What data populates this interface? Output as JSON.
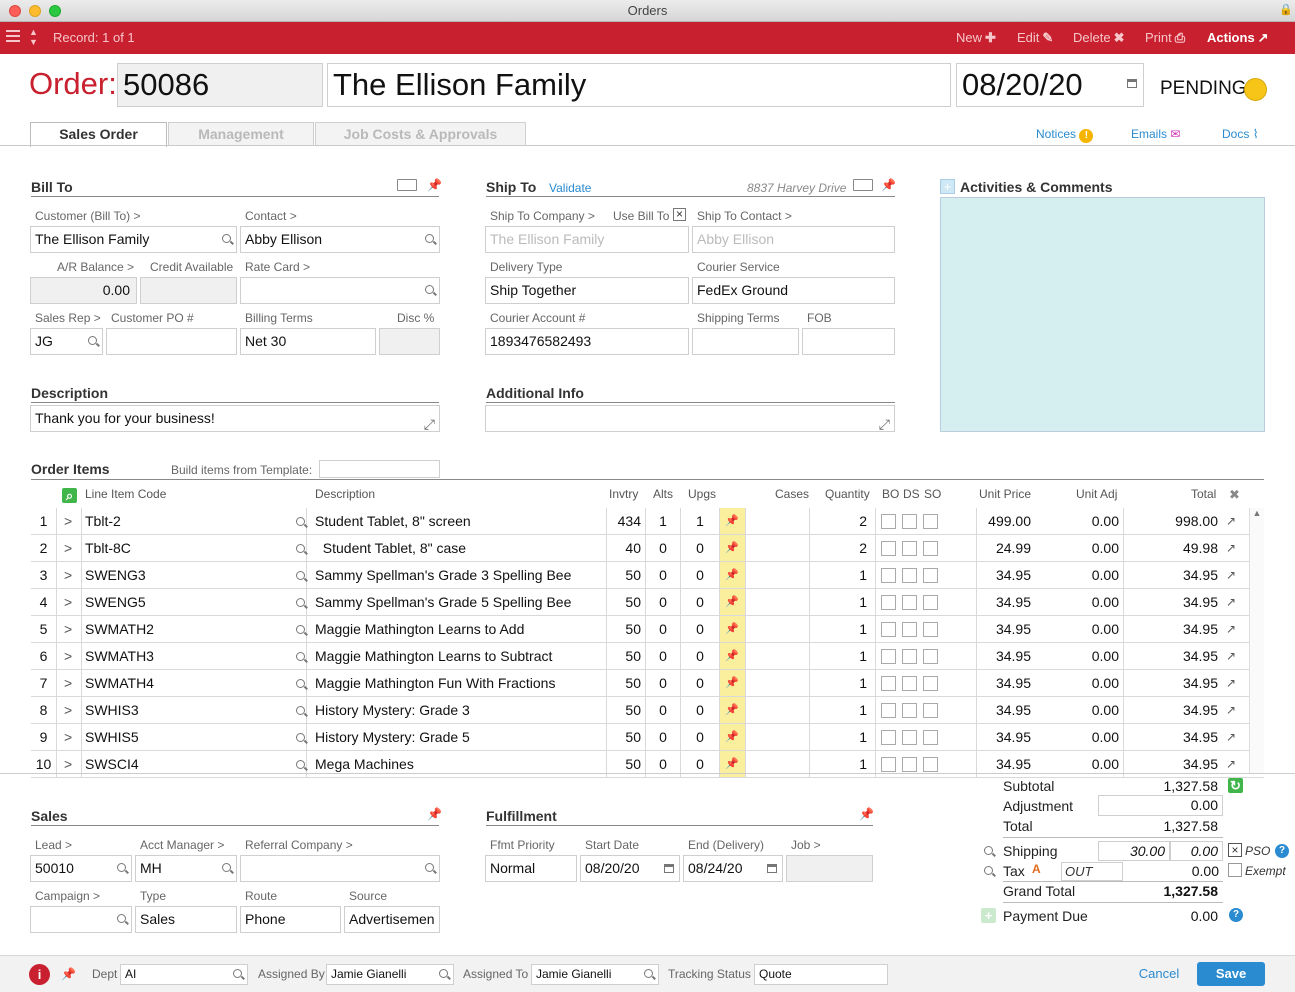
{
  "window": {
    "title": "Orders"
  },
  "toolbar": {
    "record": "Record: 1 of 1",
    "new": "New",
    "edit": "Edit",
    "delete": "Delete",
    "print": "Print",
    "actions": "Actions"
  },
  "header": {
    "order_label": "Order:",
    "order_number": "50086",
    "customer_name": "The Ellison Family",
    "date": "08/20/20",
    "status": "PENDING"
  },
  "tabs": [
    {
      "label": "Sales Order"
    },
    {
      "label": "Management"
    },
    {
      "label": "Job Costs & Approvals"
    }
  ],
  "toplinks": {
    "notices": "Notices",
    "emails": "Emails",
    "docs": "Docs"
  },
  "bill_to": {
    "title": "Bill To",
    "customer_label": "Customer (Bill To) >",
    "customer": "The Ellison Family",
    "contact_label": "Contact >",
    "contact": "Abby Ellison",
    "ar_label": "A/R Balance >",
    "ar": "0.00",
    "credit_label": "Credit Available",
    "credit": "",
    "ratecard_label": "Rate Card >",
    "ratecard": "",
    "salesrep_label": "Sales Rep >",
    "salesrep": "JG",
    "custpo_label": "Customer PO #",
    "custpo": "",
    "terms_label": "Billing Terms",
    "terms": "Net 30",
    "disc_label": "Disc %",
    "disc": ""
  },
  "ship_to": {
    "title": "Ship To",
    "validate": "Validate",
    "address_hint": "8837 Harvey Drive",
    "company_label": "Ship To Company >",
    "company": "The Ellison Family",
    "use_bill_label": "Use Bill To",
    "use_bill_mark": "×",
    "contact_label": "Ship To Contact >",
    "contact": "Abby Ellison",
    "delivery_label": "Delivery Type",
    "delivery": "Ship Together",
    "courier_label": "Courier Service",
    "courier": "FedEx Ground",
    "account_label": "Courier Account #",
    "account": "1893476582493",
    "shipterms_label": "Shipping Terms",
    "shipterms": "",
    "fob_label": "FOB",
    "fob": ""
  },
  "activities": {
    "title": "Activities & Comments"
  },
  "description": {
    "title": "Description",
    "value": "Thank you for your business!"
  },
  "additional": {
    "title": "Additional Info",
    "value": ""
  },
  "order_items": {
    "title": "Order Items",
    "template_label": "Build items from Template:",
    "columns": {
      "code": "Line Item Code",
      "desc": "Description",
      "invtry": "Invtry",
      "alts": "Alts",
      "upgs": "Upgs",
      "cases": "Cases",
      "qty": "Quantity",
      "bo": "BO",
      "ds": "DS",
      "so": "SO",
      "unit": "Unit Price",
      "adj": "Unit Adj",
      "total": "Total"
    },
    "rows": [
      {
        "n": "1",
        "code": "Tblt-2",
        "desc": "Student Tablet, 8\" screen",
        "inv": "434",
        "alts": "1",
        "upgs": "1",
        "qty": "2",
        "price": "499.00",
        "adj": "0.00",
        "total": "998.00"
      },
      {
        "n": "2",
        "code": "Tblt-8C",
        "desc": "  Student Tablet, 8\" case",
        "inv": "40",
        "alts": "0",
        "upgs": "0",
        "qty": "2",
        "price": "24.99",
        "adj": "0.00",
        "total": "49.98"
      },
      {
        "n": "3",
        "code": "SWENG3",
        "desc": "Sammy Spellman's Grade 3 Spelling Bee",
        "inv": "50",
        "alts": "0",
        "upgs": "0",
        "qty": "1",
        "price": "34.95",
        "adj": "0.00",
        "total": "34.95"
      },
      {
        "n": "4",
        "code": "SWENG5",
        "desc": "Sammy Spellman's Grade 5 Spelling Bee",
        "inv": "50",
        "alts": "0",
        "upgs": "0",
        "qty": "1",
        "price": "34.95",
        "adj": "0.00",
        "total": "34.95"
      },
      {
        "n": "5",
        "code": "SWMATH2",
        "desc": "Maggie Mathington Learns to Add",
        "inv": "50",
        "alts": "0",
        "upgs": "0",
        "qty": "1",
        "price": "34.95",
        "adj": "0.00",
        "total": "34.95"
      },
      {
        "n": "6",
        "code": "SWMATH3",
        "desc": "Maggie Mathington Learns to Subtract",
        "inv": "50",
        "alts": "0",
        "upgs": "0",
        "qty": "1",
        "price": "34.95",
        "adj": "0.00",
        "total": "34.95"
      },
      {
        "n": "7",
        "code": "SWMATH4",
        "desc": "Maggie Mathington Fun With Fractions",
        "inv": "50",
        "alts": "0",
        "upgs": "0",
        "qty": "1",
        "price": "34.95",
        "adj": "0.00",
        "total": "34.95"
      },
      {
        "n": "8",
        "code": "SWHIS3",
        "desc": "History Mystery: Grade 3",
        "inv": "50",
        "alts": "0",
        "upgs": "0",
        "qty": "1",
        "price": "34.95",
        "adj": "0.00",
        "total": "34.95"
      },
      {
        "n": "9",
        "code": "SWHIS5",
        "desc": "History Mystery: Grade 5",
        "inv": "50",
        "alts": "0",
        "upgs": "0",
        "qty": "1",
        "price": "34.95",
        "adj": "0.00",
        "total": "34.95"
      },
      {
        "n": "10",
        "code": "SWSCI4",
        "desc": "Mega Machines",
        "inv": "50",
        "alts": "0",
        "upgs": "0",
        "qty": "1",
        "price": "34.95",
        "adj": "0.00",
        "total": "34.95"
      }
    ]
  },
  "sales": {
    "title": "Sales",
    "lead_label": "Lead >",
    "lead": "50010",
    "acct_label": "Acct Manager >",
    "acct": "MH",
    "ref_label": "Referral Company >",
    "ref": "",
    "campaign_label": "Campaign >",
    "campaign": "",
    "type_label": "Type",
    "type": "Sales",
    "route_label": "Route",
    "route": "Phone",
    "source_label": "Source",
    "source": "Advertisemen"
  },
  "fulfillment": {
    "title": "Fulfillment",
    "priority_label": "Ffmt Priority",
    "priority": "Normal",
    "start_label": "Start Date",
    "start": "08/20/20",
    "end_label": "End (Delivery)",
    "end": "08/24/20",
    "job_label": "Job >",
    "job": ""
  },
  "totals": {
    "subtotal_label": "Subtotal",
    "subtotal": "1,327.58",
    "adjustment_label": "Adjustment",
    "adjustment": "0.00",
    "total_label": "Total",
    "total": "1,327.58",
    "shipping_label": "Shipping",
    "shipping_rate": "30.00",
    "shipping": "0.00",
    "pso_mark": "×",
    "pso": "PSO",
    "tax_label": "Tax",
    "tax_code": "OUT",
    "tax": "0.00",
    "exempt": "Exempt",
    "grand_label": "Grand Total",
    "grand": "1,327.58",
    "due_label": "Payment Due",
    "due": "0.00"
  },
  "statusbar": {
    "dept_label": "Dept",
    "dept": "AI",
    "assigned_by_label": "Assigned By",
    "assigned_by": "Jamie Gianelli",
    "assigned_to_label": "Assigned To",
    "assigned_to": "Jamie Gianelli",
    "tracking_label": "Tracking Status",
    "tracking": "Quote",
    "cancel": "Cancel",
    "save": "Save"
  },
  "colors": {
    "brand": "#c8202e",
    "accent": "#2a8bd1",
    "pending": "#f7c517",
    "activity_bg": "#d5eff1"
  }
}
